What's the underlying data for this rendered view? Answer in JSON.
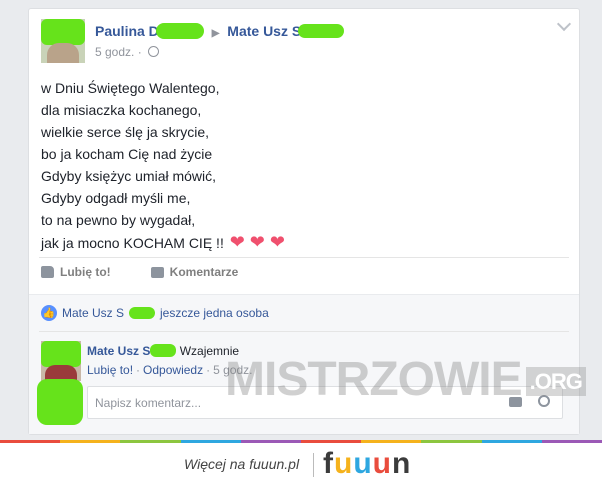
{
  "post": {
    "author_visible": "Paulina D",
    "target_visible": "Mate Usz S",
    "time": "5 godz.",
    "separator": "·",
    "lines": [
      "w Dniu Świętego Walentego,",
      "dla misiaczka kochanego,",
      "wielkie serce ślę ja skrycie,",
      "bo ja kocham Cię nad życie",
      "Gdyby księżyc umiał mówić,",
      "Gdyby odgadł myśli me,",
      "to na pewno by wygadał,",
      "jak ja mocno KOCHAM CIĘ !!"
    ],
    "hearts": "❤ ❤ ❤"
  },
  "actions": {
    "like": "Lubię to!",
    "comment": "Komentarze"
  },
  "likes": {
    "who": "Mate Usz S",
    "rest": "jeszcze jedna osoba"
  },
  "comment": {
    "name_visible": "Mate Usz S",
    "text": "Wzajemnie",
    "like": "Lubię to!",
    "reply": "Odpowiedz",
    "time": "5 godz."
  },
  "input": {
    "placeholder": "Napisz komentarz..."
  },
  "watermark": {
    "main": "MISTRZOWIE",
    "org": ".ORG"
  },
  "footer": {
    "more": "Więcej na fuuun.pl",
    "brand_letters": [
      "f",
      "u",
      "u",
      "u",
      "n"
    ]
  },
  "colors": {
    "link": "#365899",
    "redaction": "#66e31b",
    "brand": [
      "#3b3b3b",
      "#f5b21c",
      "#2ea7e0",
      "#e94c3d",
      "#3b3b3b"
    ],
    "stripe": [
      "#e94c3d",
      "#f5b21c",
      "#8cc63f",
      "#2ea7e0",
      "#9b59b6",
      "#e94c3d",
      "#f5b21c",
      "#8cc63f",
      "#2ea7e0",
      "#9b59b6"
    ]
  }
}
